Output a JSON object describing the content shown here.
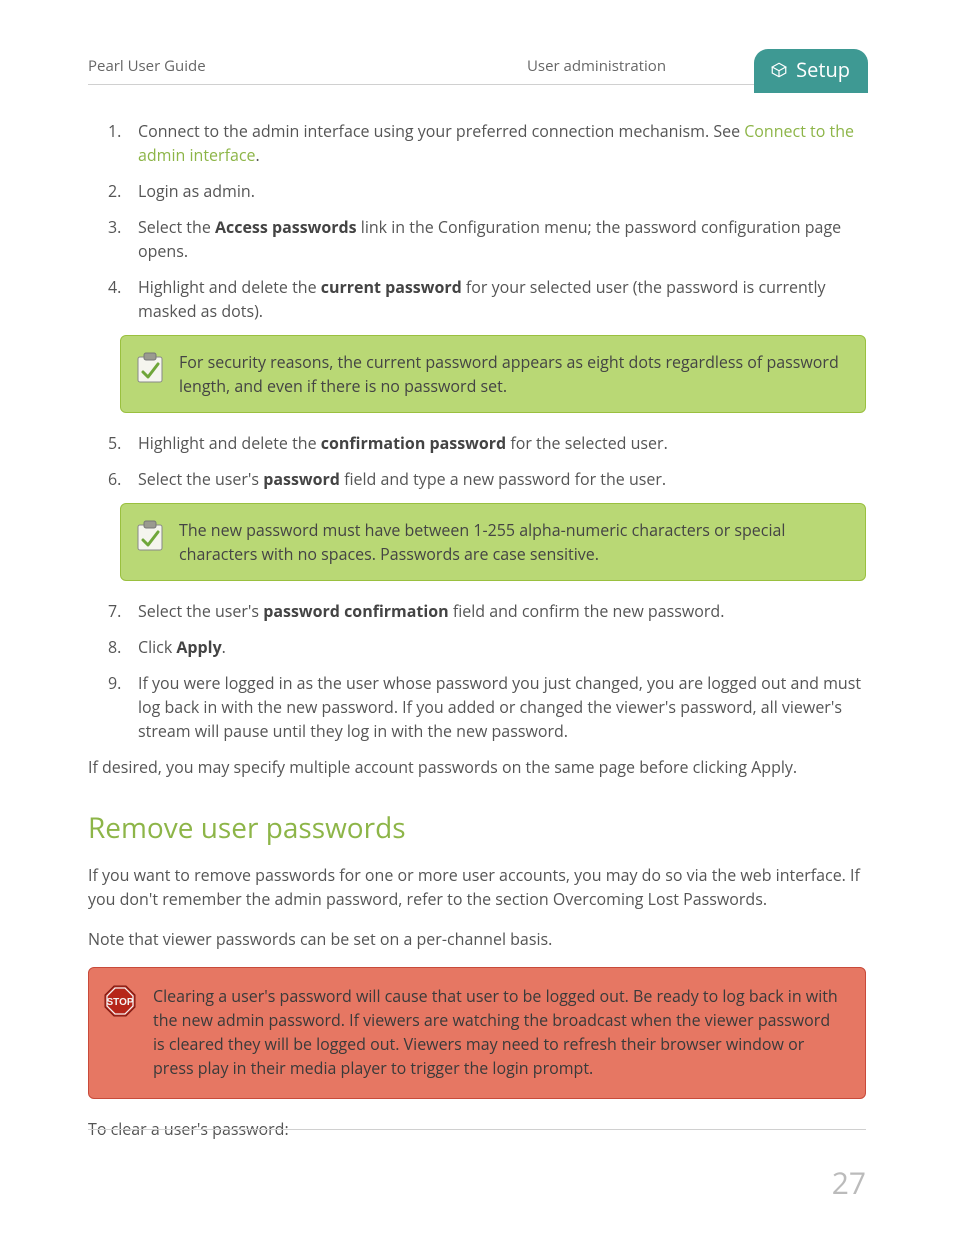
{
  "header": {
    "left": "Pearl User Guide",
    "center": "User administration",
    "tab": "Setup"
  },
  "steps_a": {
    "s1_pre": "Connect to the admin interface using your preferred connection mechanism. See ",
    "s1_link": "Connect to the admin interface",
    "s1_post": ".",
    "s2": "Login as admin.",
    "s3_a": "Select the ",
    "s3_b": "Access passwords",
    "s3_c": " link in the Configuration menu; the password configuration page opens.",
    "s4_a": "Highlight and delete the ",
    "s4_b": "current password",
    "s4_c": " for your selected user (the password is currently masked as dots)."
  },
  "note1": "For security reasons, the current password appears as eight dots regardless of password length, and even if there is no password set.",
  "steps_b": {
    "s5_a": "Highlight and delete the ",
    "s5_b": "confirmation password",
    "s5_c": " for the selected user.",
    "s6_a": "Select the user's ",
    "s6_b": "password",
    "s6_c": " field and type a new password for the user."
  },
  "note2": "The new password must have between 1-255 alpha-numeric characters or special characters with no spaces. Passwords are case sensitive.",
  "steps_c": {
    "s7_a": "Select the user's ",
    "s7_b": "password confirmation",
    "s7_c": " field and confirm the new password.",
    "s8_a": "Click ",
    "s8_b": "Apply",
    "s8_c": ".",
    "s9": "If you were logged in as the user whose password you just changed, you are logged out and must log back in with the new password. If you added or changed the viewer's password, all viewer's stream will pause until they log in with the new password."
  },
  "p_after": "If desired, you may specify multiple account passwords on the same page before clicking Apply.",
  "section2": {
    "heading": "Remove user passwords",
    "p1": "If you want to remove passwords for one or more user accounts, you may do so via the web interface. If you don't remember the admin password, refer to the section Overcoming Lost Passwords.",
    "p2": "Note that viewer passwords can be set on a per-channel basis.",
    "stop_note": "Clearing a user's password will cause that user to be logged out. Be ready to log back in with the new admin password. If viewers are watching the broadcast when the viewer password is cleared they will be logged out. Viewers may need to refresh their browser window or press play in their media player to trigger the login prompt.",
    "p3": "To clear a user's password:"
  },
  "page_number": "27"
}
